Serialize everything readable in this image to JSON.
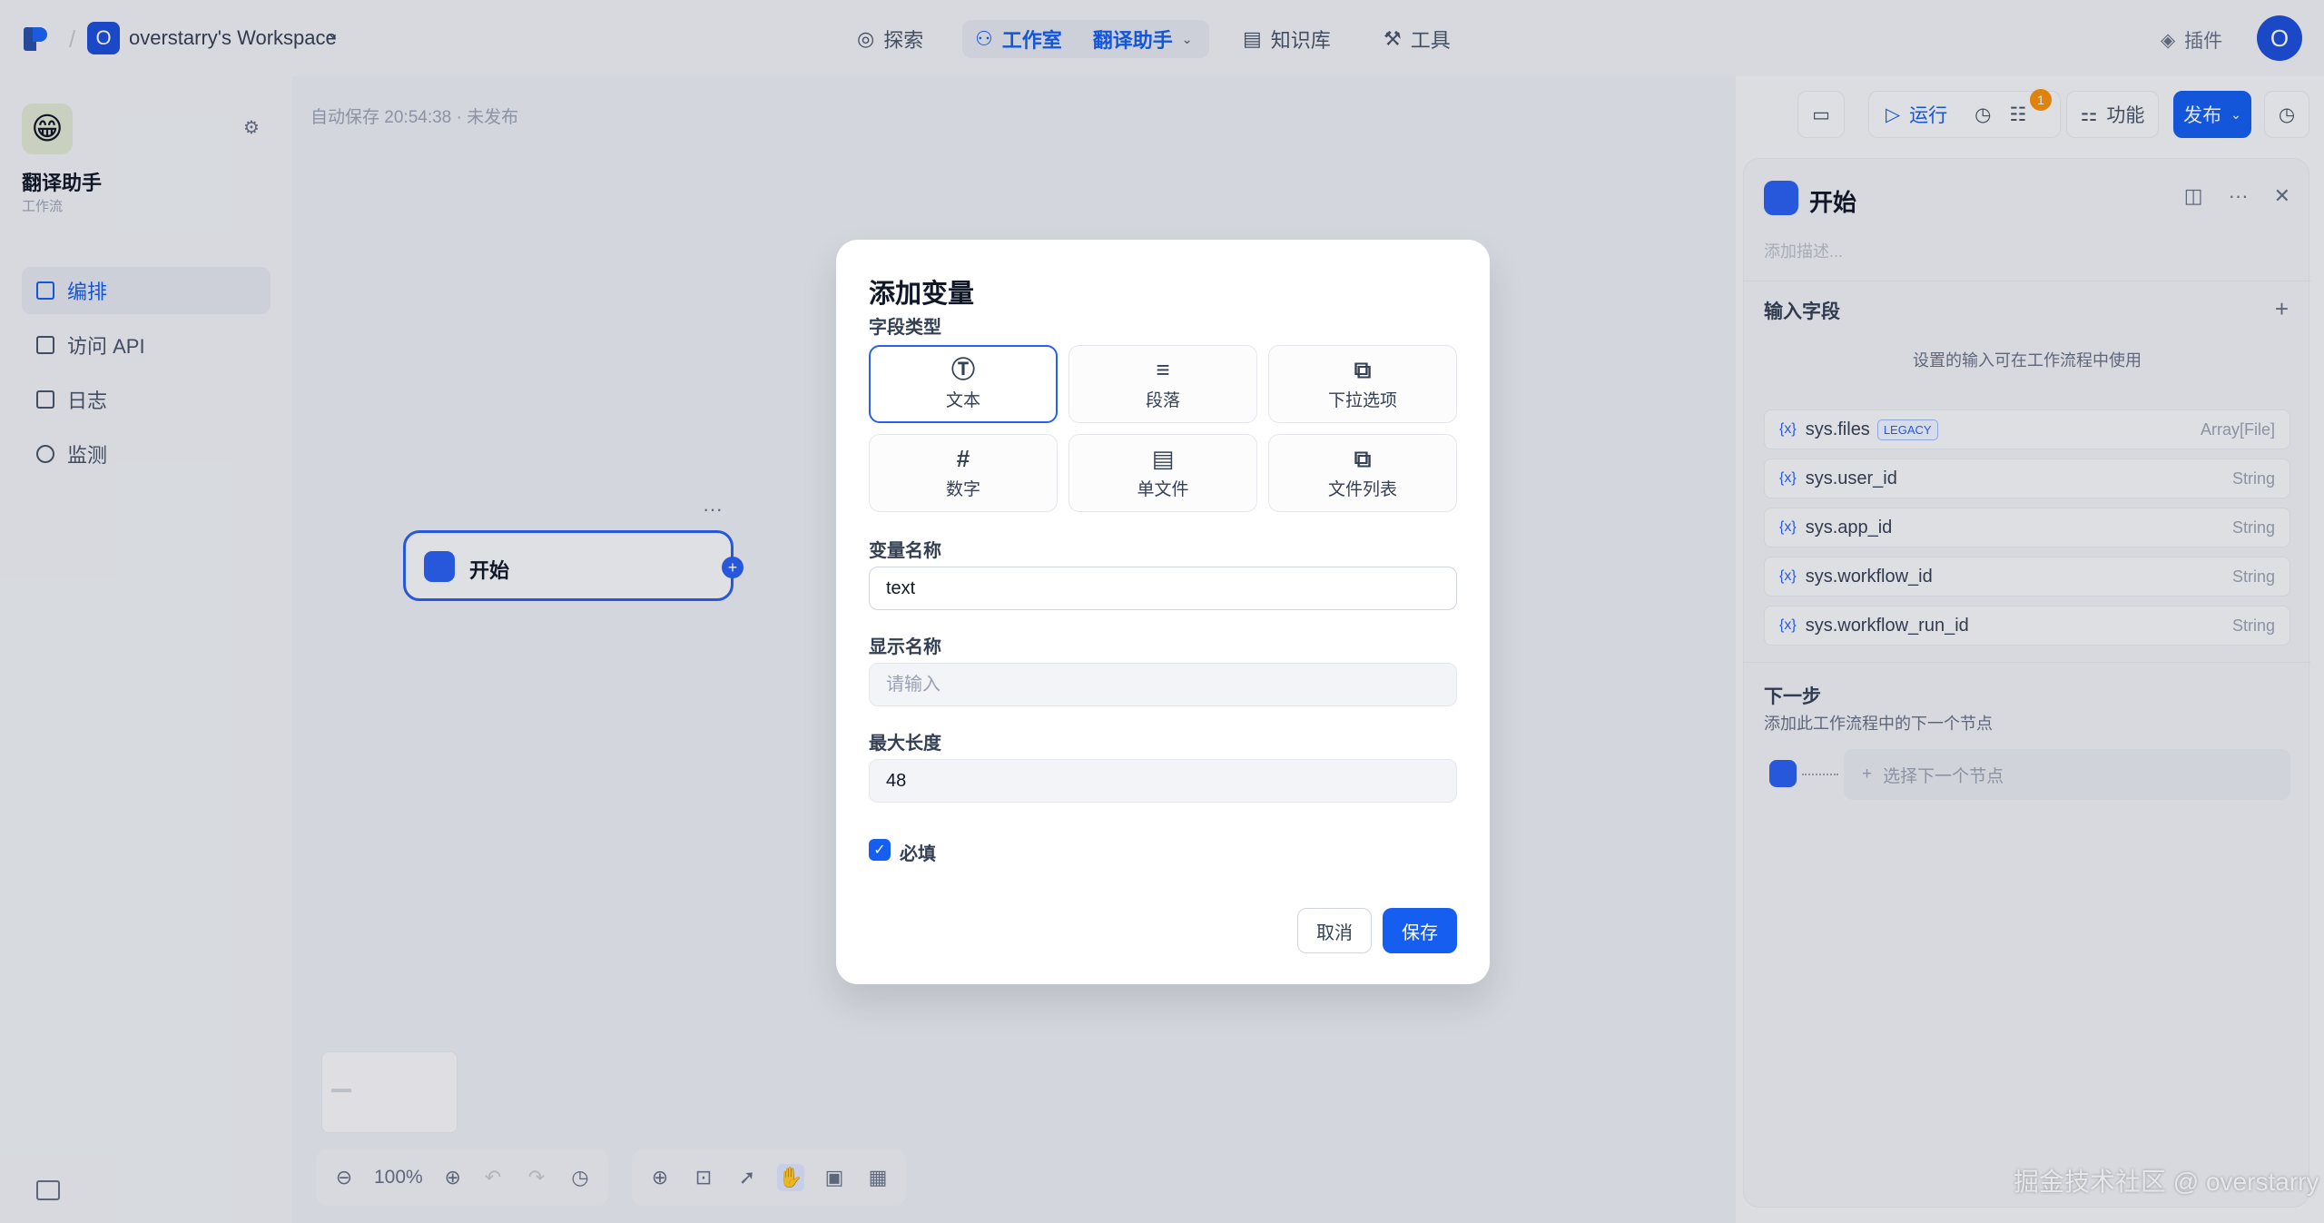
{
  "topbar": {
    "workspace_initial": "O",
    "workspace_name": "overstarry's Workspace",
    "nav": {
      "explore": "探索",
      "studio": "工作室",
      "current_app": "翻译助手",
      "knowledge": "知识库",
      "tools": "工具"
    },
    "plugins": "插件",
    "user_initial": "O"
  },
  "sidebar": {
    "app_name": "翻译助手",
    "app_type": "工作流",
    "items": [
      {
        "label": "编排"
      },
      {
        "label": "访问 API"
      },
      {
        "label": "日志"
      },
      {
        "label": "监测"
      }
    ]
  },
  "canvas": {
    "autosave": "自动保存 20:54:38 · 未发布",
    "start_node_label": "开始",
    "zoom": "100%",
    "run_label": "运行",
    "checklist_count": "1",
    "features_label": "功能",
    "publish_label": "发布"
  },
  "panel": {
    "title": "开始",
    "description_placeholder": "添加描述...",
    "input_fields_heading": "输入字段",
    "hint": "设置的输入可在工作流程中使用",
    "vars": [
      {
        "name": "sys.files",
        "badge": "LEGACY",
        "type": "Array[File]"
      },
      {
        "name": "sys.user_id",
        "type": "String"
      },
      {
        "name": "sys.app_id",
        "type": "String"
      },
      {
        "name": "sys.workflow_id",
        "type": "String"
      },
      {
        "name": "sys.workflow_run_id",
        "type": "String"
      }
    ],
    "next_heading": "下一步",
    "next_desc": "添加此工作流程中的下一个节点",
    "next_select": "选择下一个节点"
  },
  "modal": {
    "title": "添加变量",
    "field_type_label": "字段类型",
    "types": [
      {
        "label": "文本",
        "icon": "text-type-icon"
      },
      {
        "label": "段落",
        "icon": "paragraph-icon"
      },
      {
        "label": "下拉选项",
        "icon": "select-icon"
      },
      {
        "label": "数字",
        "icon": "hash-icon"
      },
      {
        "label": "单文件",
        "icon": "file-icon"
      },
      {
        "label": "文件列表",
        "icon": "file-list-icon"
      }
    ],
    "var_name_label": "变量名称",
    "var_name_value": "text",
    "display_name_label": "显示名称",
    "display_name_placeholder": "请输入",
    "max_length_label": "最大长度",
    "max_length_value": "48",
    "required_label": "必填",
    "cancel_label": "取消",
    "save_label": "保存"
  },
  "watermark": "掘金技术社区 @ overstarry",
  "colors": {
    "accent": "#155eef",
    "badge": "#f79009"
  }
}
